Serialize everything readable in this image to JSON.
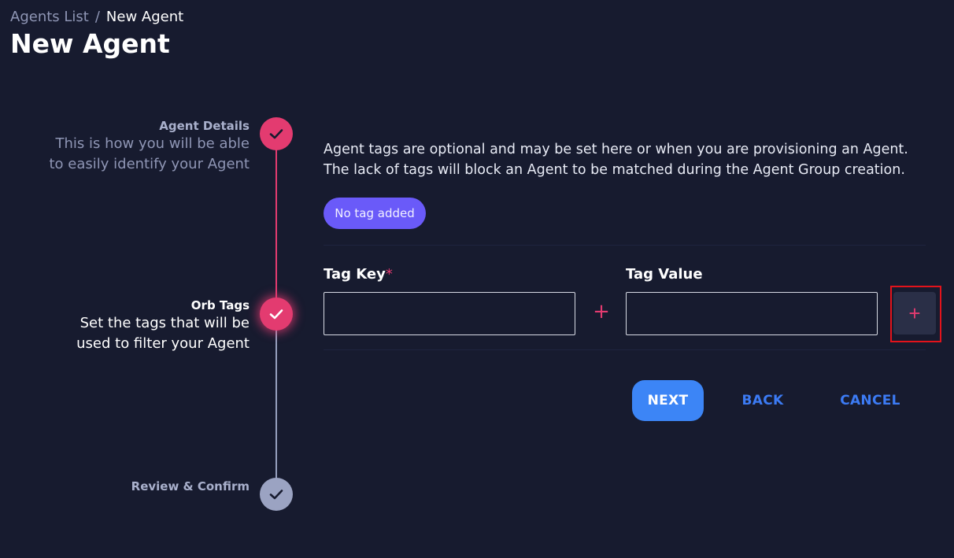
{
  "breadcrumb": {
    "parent": "Agents List",
    "separator": "/",
    "current": "New Agent"
  },
  "page_title": "New Agent",
  "stepper": {
    "steps": [
      {
        "title": "Agent Details",
        "desc_line1": "This is how you will be able",
        "desc_line2": "to easily identify your Agent",
        "state": "done"
      },
      {
        "title": "Orb Tags",
        "desc_line1": "Set the tags that will be",
        "desc_line2": "used to filter your Agent",
        "state": "active"
      },
      {
        "title": "Review & Confirm",
        "state": "pending"
      }
    ]
  },
  "tags": {
    "info_line1": "Agent tags are optional and may be set here or when you are provisioning an Agent.",
    "info_line2": "The lack of tags will block an Agent to be matched during the Agent Group creation.",
    "empty_badge": "No tag added",
    "key_label": "Tag Key",
    "key_required_mark": "*",
    "key_value": "",
    "value_label": "Tag Value",
    "value_value": "",
    "add_icon": "plus-icon"
  },
  "actions": {
    "next": "NEXT",
    "back": "BACK",
    "cancel": "CANCEL"
  },
  "colors": {
    "background": "#171b2f",
    "accent": "#e33b70",
    "primary": "#3c85f6",
    "badge": "#6a5af9"
  }
}
